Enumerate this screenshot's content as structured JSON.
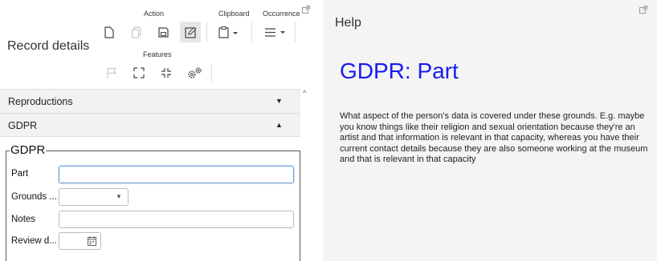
{
  "record": {
    "title": "Record details"
  },
  "toolbar": {
    "groups": {
      "action": "Action",
      "clipboard": "Clipboard",
      "occurrence": "Occurrence",
      "features": "Features"
    },
    "icons": {
      "new": "new-document-icon",
      "copy": "copy-icon",
      "save": "save-icon",
      "edit": "edit-icon",
      "clipboard": "clipboard-icon",
      "occurrence": "list-icon",
      "flag": "flag-icon",
      "expand": "expand-icon",
      "collapse": "collapse-icon",
      "settings": "settings-cogs-icon"
    }
  },
  "sections": {
    "reproductions": "Reproductions",
    "gdpr": "GDPR"
  },
  "gdpr_form": {
    "legend": "GDPR",
    "part_label": "Part",
    "part_value": "",
    "grounds_label": "Grounds ...",
    "grounds_value": "",
    "notes_label": "Notes",
    "notes_value": "",
    "review_label": "Review d...",
    "review_value": ""
  },
  "help": {
    "title": "Help",
    "heading": "GDPR: Part",
    "body": "What aspect of the person's data is covered under these grounds. E.g. maybe you know things like their religion and sexual orientation because they're an artist and that information is relevant in that capacity, whereas you have their current contact details because they are also someone working at the museum and that is relevant in that capacity"
  },
  "colors": {
    "heading_blue": "#1a1af0",
    "help_background": "#f4f4f4",
    "accordion_background": "#f2f2f2",
    "focus_border": "#6d9bd1"
  }
}
